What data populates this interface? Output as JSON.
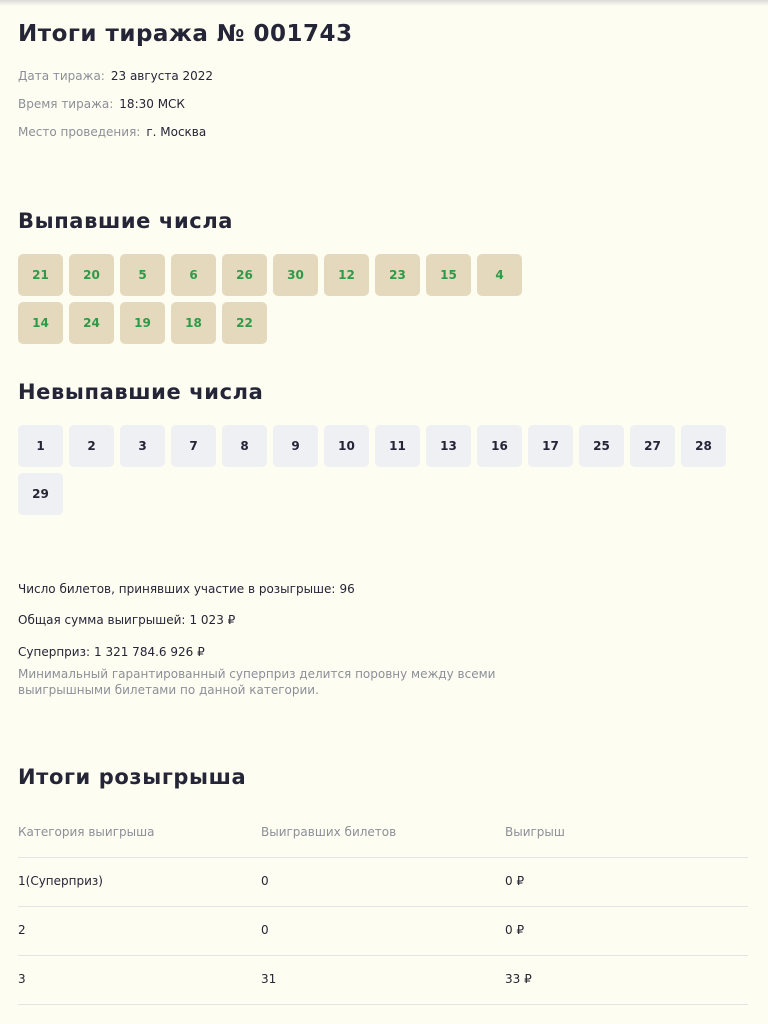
{
  "draw": {
    "title": "Итоги тиража № 001743",
    "date_label": "Дата тиража:",
    "date_value": "23 августа 2022",
    "time_label": "Время тиража:",
    "time_value": "18:30 МСК",
    "place_label": "Место проведения:",
    "place_value": "г. Москва"
  },
  "drawn_numbers": {
    "title": "Выпавшие числа",
    "values": [
      "21",
      "20",
      "5",
      "6",
      "26",
      "30",
      "12",
      "23",
      "15",
      "4",
      "14",
      "24",
      "19",
      "18",
      "22"
    ]
  },
  "undrawn_numbers": {
    "title": "Невыпавшие числа",
    "values": [
      "1",
      "2",
      "3",
      "7",
      "8",
      "9",
      "10",
      "11",
      "13",
      "16",
      "17",
      "25",
      "27",
      "28",
      "29"
    ]
  },
  "stats": {
    "tickets_label": "Число билетов, принявших участие в розыгрыше:",
    "tickets_value": "96",
    "total_label": "Общая сумма выигрышей:",
    "total_value": "1 023 ₽",
    "superprize_label": "Суперприз:",
    "superprize_value": "1 321 784.6 926 ₽",
    "note": "Минимальный гарантированный суперприз делится поровну между всеми выигрышными билетами по данной категории."
  },
  "results": {
    "title": "Итоги розыгрыша",
    "columns": [
      "Категория выигрыша",
      "Выигравших билетов",
      "Выигрыш"
    ],
    "rows": [
      [
        "1(Суперприз)",
        "0",
        "0 ₽"
      ],
      [
        "2",
        "0",
        "0 ₽"
      ],
      [
        "3",
        "31",
        "33 ₽"
      ]
    ]
  },
  "colors": {
    "background": "#fefdf1",
    "drawn_ball_bg": "#e4d9bc",
    "drawn_ball_text": "#2e9a48",
    "undrawn_ball_bg": "#eef0f3",
    "muted_text": "#8c8f99",
    "heading_text": "#252538"
  }
}
